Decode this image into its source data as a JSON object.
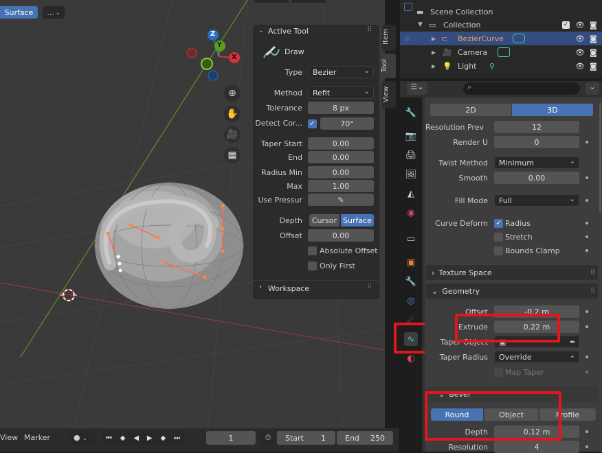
{
  "header": {
    "mode_label": "Surface",
    "dropdown_label": "..."
  },
  "viewport": {
    "gizmo": {
      "z": "Z",
      "y": "Y",
      "x": "X"
    },
    "vtabs": {
      "item": "Item",
      "tool": "Tool",
      "view": "View"
    }
  },
  "active_tool": {
    "title": "Active Tool",
    "tool_name": "Draw",
    "type_label": "Type",
    "type_value": "Bezier",
    "method_label": "Method",
    "method_value": "Refit",
    "tolerance_label": "Tolerance",
    "tolerance_value": "8 px",
    "detect_label": "Detect Cor...",
    "detect_value": "70°",
    "taper_start_label": "Taper Start",
    "taper_start_value": "0.00",
    "end_label": "End",
    "end_value": "0.00",
    "radius_min_label": "Radius Min",
    "radius_min_value": "0.00",
    "max_label": "Max",
    "max_value": "1.00",
    "use_pressure_label": "Use Pressur",
    "depth_label": "Depth",
    "depth_cursor": "Cursor",
    "depth_surface": "Surface",
    "offset_label": "Offset",
    "offset_value": "0.00",
    "absolute_offset": "Absolute Offset",
    "only_first": "Only First",
    "workspace": "Workspace"
  },
  "outliner": {
    "rows": [
      {
        "label": "Scene Collection"
      },
      {
        "label": "Collection"
      },
      {
        "label": "BezierCurve"
      },
      {
        "label": "Camera"
      },
      {
        "label": "Light"
      }
    ]
  },
  "properties": {
    "dim_2d": "2D",
    "dim_3d": "3D",
    "resolution_prev_label": "Resolution Prev",
    "resolution_prev_value": "12",
    "render_u_label": "Render U",
    "render_u_value": "0",
    "twist_method_label": "Twist Method",
    "twist_method_value": "Minimum",
    "smooth_label": "Smooth",
    "smooth_value": "0.00",
    "fill_mode_label": "Fill Mode",
    "fill_mode_value": "Full",
    "curve_deform_label": "Curve Deform",
    "radius_label": "Radius",
    "stretch_label": "Stretch",
    "bounds_clamp_label": "Bounds Clamp",
    "texture_space": "Texture Space",
    "geometry": "Geometry",
    "offset_label": "Offset",
    "offset_value": "-0.2 m",
    "extrude_label": "Extrude",
    "extrude_value": "0.22 m",
    "taper_object_label": "Taper Object",
    "taper_radius_label": "Taper Radius",
    "taper_radius_value": "Override",
    "map_taper_label": "Map Taper",
    "bevel": "Bevel",
    "bevel_round": "Round",
    "bevel_object": "Object",
    "bevel_profile": "Profile",
    "depth_label": "Depth",
    "depth_value": "0.12 m",
    "resolution_label": "Resolution",
    "resolution_value": "4"
  },
  "timeline": {
    "view": "View",
    "marker": "Marker",
    "current_frame": "1",
    "start_label": "Start",
    "start_value": "1",
    "end_label": "End",
    "end_value": "250"
  },
  "colors": {
    "accent": "#4772b3",
    "highlight": "#e5141d",
    "active_row": "#334d80"
  }
}
